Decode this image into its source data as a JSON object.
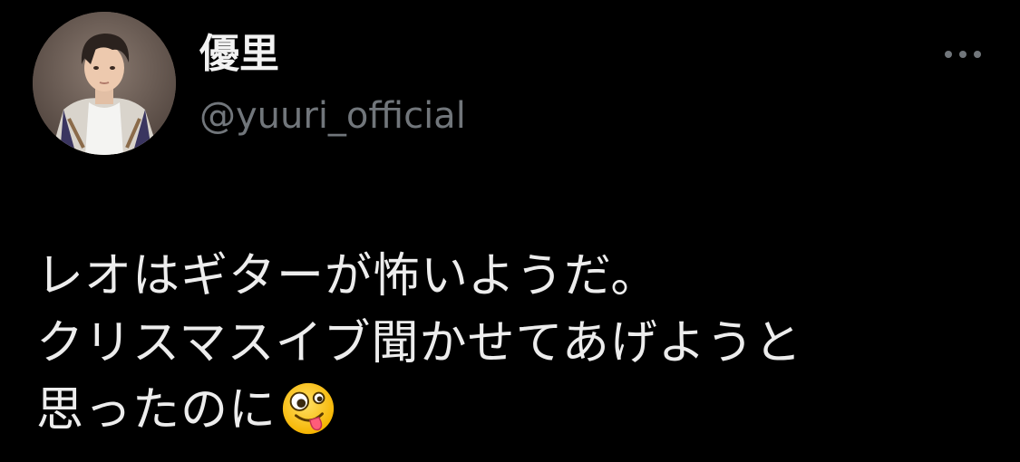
{
  "author": {
    "display_name": "優里",
    "handle": "@yuuri_official",
    "avatar_icon": "profile-photo-avatar"
  },
  "header": {
    "more_icon": "more-options-icon"
  },
  "tweet": {
    "lines": [
      "レオはギターが怖いようだ。",
      "クリスマスイブ聞かせてあげようと",
      "思ったのに"
    ],
    "emoji": "zany-face-emoji"
  },
  "colors": {
    "background": "#000000",
    "text_primary": "#e7e9ea",
    "text_secondary": "#71767b"
  }
}
